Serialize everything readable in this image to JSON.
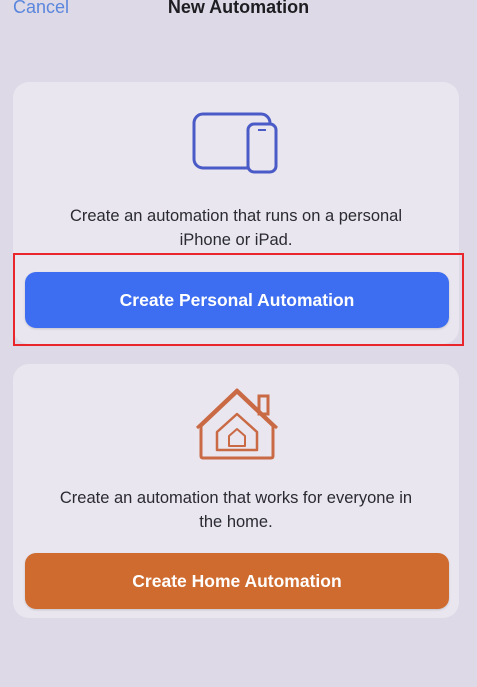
{
  "nav": {
    "cancel_label": "Cancel",
    "title": "New Automation"
  },
  "personal": {
    "icon": "devices-icon",
    "description_line1": "Create an automation that runs on a personal",
    "description_line2": "iPhone or iPad.",
    "button_label": "Create Personal Automation",
    "button_color": "#3d6df0",
    "icon_color": "#4a5ac7"
  },
  "home": {
    "icon": "home-icon",
    "description_line1": "Create an automation that works for everyone in",
    "description_line2": "the home.",
    "button_label": "Create Home Automation",
    "button_color": "#cf6b2f",
    "icon_color": "#c96a45"
  },
  "annotation": {
    "highlight_color": "#e8262c",
    "highlight_target": "create-personal-automation-button"
  }
}
